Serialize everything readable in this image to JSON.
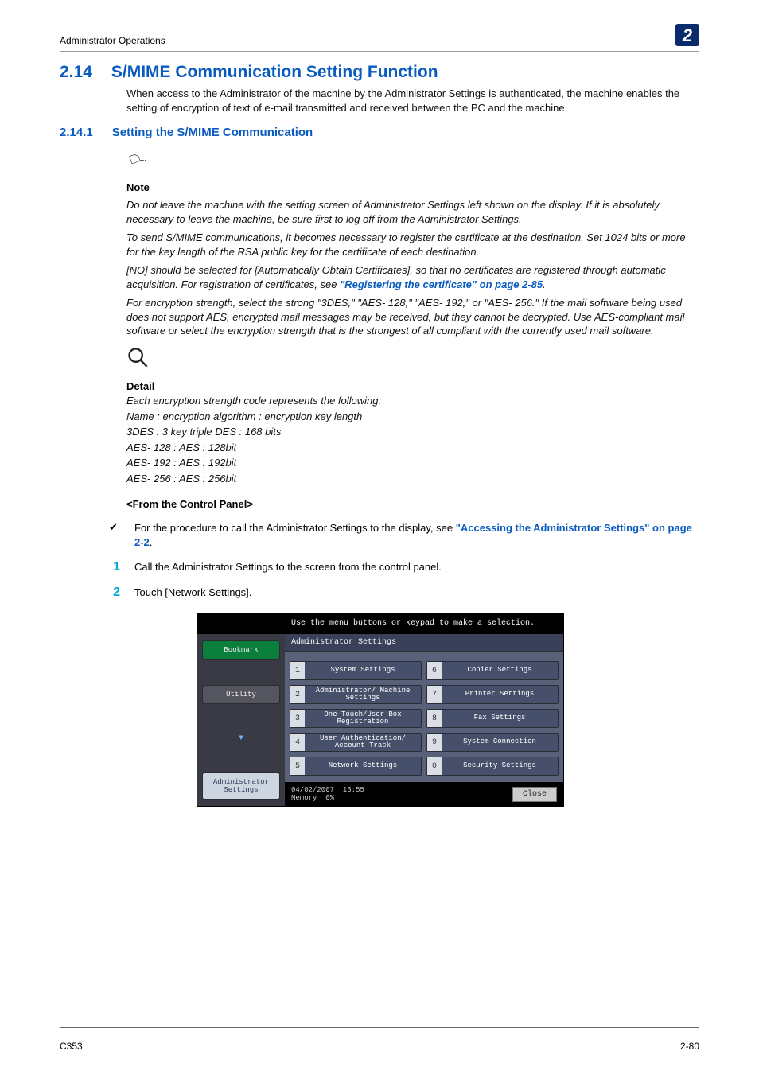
{
  "header": {
    "title": "Administrator Operations",
    "chapter": "2"
  },
  "h1": {
    "num": "2.14",
    "text": "S/MIME Communication Setting Function"
  },
  "intro": "When access to the Administrator of the machine by the Administrator Settings is authenticated, the machine enables the setting of encryption of text of e-mail transmitted and received between the PC and the machine.",
  "h2": {
    "num": "2.14.1",
    "text": "Setting the S/MIME Communication"
  },
  "note_label": "Note",
  "notes": {
    "n1": "Do not leave the machine with the setting screen of Administrator Settings left shown on the display. If it is absolutely necessary to leave the machine, be sure first to log off from the Administrator Settings.",
    "n2": "To send S/MIME communications, it becomes necessary to register the certificate at the destination. Set 1024 bits or more for the key length of the RSA public key for the certificate of each destination.",
    "n3_a": "[NO] should be selected for [Automatically Obtain Certificates], so that no certificates are registered through automatic acquisition. For registration of certificates, see ",
    "n3_link": "\"Registering the certificate\" on page 2-85",
    "n3_b": ".",
    "n4": "For encryption strength, select the strong \"3DES,\" \"AES- 128,\" \"AES- 192,\" or \"AES- 256.\" If the mail software being used does not support AES, encrypted mail messages may be received, but they cannot be decrypted. Use AES-compliant mail software or select the encryption strength that is the strongest of all compliant with the currently used mail software."
  },
  "detail_label": "Detail",
  "detail": {
    "d1": "Each encryption strength code represents the following.",
    "d2": "Name : encryption algorithm : encryption key length",
    "d3": "3DES : 3 key triple DES : 168 bits",
    "d4": "AES- 128 : AES : 128bit",
    "d5": "AES- 192 : AES : 192bit",
    "d6": "AES- 256 : AES : 256bit"
  },
  "cp_heading": "<From the Control Panel>",
  "check_a": "For the procedure to call the Administrator Settings to the display, see ",
  "check_link": "\"Accessing the Administrator Settings\" on page 2-2",
  "check_b": ".",
  "steps": {
    "s1": {
      "n": "1",
      "t": "Call the Administrator Settings to the screen from the control panel."
    },
    "s2": {
      "n": "2",
      "t": "Touch [Network Settings]."
    }
  },
  "panel": {
    "instruction": "Use the menu buttons or keypad to make a selection.",
    "breadcrumb": "Administrator Settings",
    "side": {
      "bookmark": "Bookmark",
      "utility": "Utility",
      "admin": "Administrator Settings"
    },
    "items": [
      {
        "n": "1",
        "label": "System Settings"
      },
      {
        "n": "2",
        "label": "Administrator/ Machine Settings"
      },
      {
        "n": "3",
        "label": "One-Touch/User Box Registration"
      },
      {
        "n": "4",
        "label": "User Authentication/ Account Track"
      },
      {
        "n": "5",
        "label": "Network Settings"
      },
      {
        "n": "6",
        "label": "Copier Settings"
      },
      {
        "n": "7",
        "label": "Printer Settings"
      },
      {
        "n": "8",
        "label": "Fax Settings"
      },
      {
        "n": "9",
        "label": "System Connection"
      },
      {
        "n": "0",
        "label": "Security Settings"
      }
    ],
    "status": {
      "date": "04/02/2007",
      "time": "13:55",
      "mem_label": "Memory",
      "mem_val": "0%"
    },
    "close": "Close"
  },
  "footer": {
    "left": "C353",
    "right": "2-80"
  }
}
